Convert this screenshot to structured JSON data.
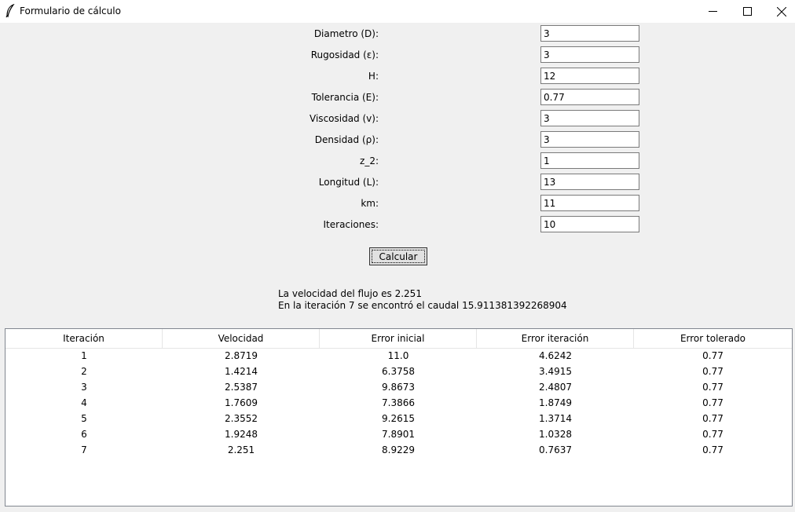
{
  "window": {
    "title": "Formulario de cálculo"
  },
  "form": {
    "fields": [
      {
        "label": "Diametro (D):",
        "value": "3"
      },
      {
        "label": "Rugosidad (ε):",
        "value": "3"
      },
      {
        "label": "H:",
        "value": "12"
      },
      {
        "label": "Tolerancia (E):",
        "value": "0.77"
      },
      {
        "label": "Viscosidad (v):",
        "value": "3"
      },
      {
        "label": "Densidad (ρ):",
        "value": "3"
      },
      {
        "label": "z_2:",
        "value": "1"
      },
      {
        "label": "Longitud (L):",
        "value": "13"
      },
      {
        "label": "km:",
        "value": "11"
      },
      {
        "label": "Iteraciones:",
        "value": "10"
      }
    ],
    "calc_button_label": "Calcular"
  },
  "results": {
    "line1": "La velocidad del flujo es 2.251",
    "line2": "En la iteración 7 se encontró el caudal 15.911381392268904"
  },
  "table": {
    "headers": [
      "Iteración",
      "Velocidad",
      "Error inicial",
      "Error iteración",
      "Error tolerado"
    ],
    "rows": [
      [
        "1",
        "2.8719",
        "11.0",
        "4.6242",
        "0.77"
      ],
      [
        "2",
        "1.4214",
        "6.3758",
        "3.4915",
        "0.77"
      ],
      [
        "3",
        "2.5387",
        "9.8673",
        "2.4807",
        "0.77"
      ],
      [
        "4",
        "1.7609",
        "7.3866",
        "1.8749",
        "0.77"
      ],
      [
        "5",
        "2.3552",
        "9.2615",
        "1.3714",
        "0.77"
      ],
      [
        "6",
        "1.9248",
        "7.8901",
        "1.0328",
        "0.77"
      ],
      [
        "7",
        "2.251",
        "8.9229",
        "0.7637",
        "0.77"
      ]
    ]
  }
}
